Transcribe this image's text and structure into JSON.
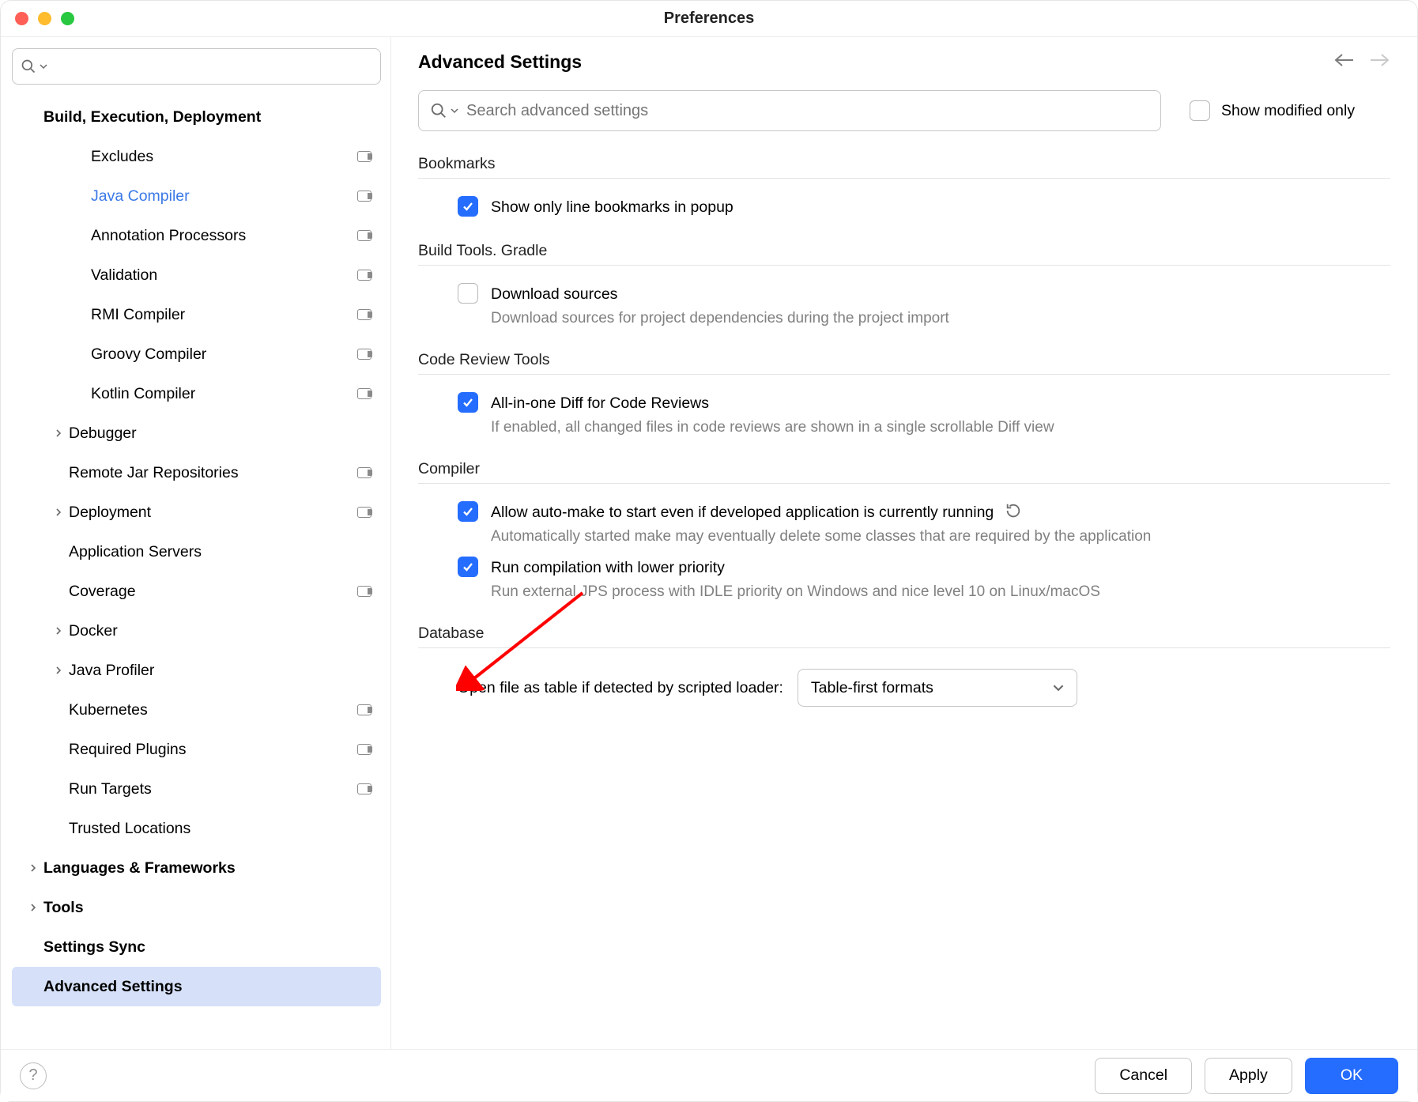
{
  "window": {
    "title": "Preferences"
  },
  "sidebar": {
    "search_placeholder": "",
    "items": [
      {
        "label": "Build, Execution, Deployment",
        "indent": 40,
        "bold": true,
        "chevron": false,
        "badge": false,
        "interactable": true
      },
      {
        "label": "Excludes",
        "indent": 100,
        "bold": false,
        "chevron": false,
        "badge": true,
        "interactable": true
      },
      {
        "label": "Java Compiler",
        "indent": 100,
        "bold": false,
        "chevron": false,
        "badge": true,
        "interactable": true,
        "blue": true
      },
      {
        "label": "Annotation Processors",
        "indent": 100,
        "bold": false,
        "chevron": false,
        "badge": true,
        "interactable": true
      },
      {
        "label": "Validation",
        "indent": 100,
        "bold": false,
        "chevron": false,
        "badge": true,
        "interactable": true
      },
      {
        "label": "RMI Compiler",
        "indent": 100,
        "bold": false,
        "chevron": false,
        "badge": true,
        "interactable": true
      },
      {
        "label": "Groovy Compiler",
        "indent": 100,
        "bold": false,
        "chevron": false,
        "badge": true,
        "interactable": true
      },
      {
        "label": "Kotlin Compiler",
        "indent": 100,
        "bold": false,
        "chevron": false,
        "badge": true,
        "interactable": true
      },
      {
        "label": "Debugger",
        "indent": 72,
        "bold": false,
        "chevron": true,
        "badge": false,
        "interactable": true
      },
      {
        "label": "Remote Jar Repositories",
        "indent": 72,
        "bold": false,
        "chevron": false,
        "badge": true,
        "interactable": true
      },
      {
        "label": "Deployment",
        "indent": 72,
        "bold": false,
        "chevron": true,
        "badge": true,
        "interactable": true
      },
      {
        "label": "Application Servers",
        "indent": 72,
        "bold": false,
        "chevron": false,
        "badge": false,
        "interactable": true
      },
      {
        "label": "Coverage",
        "indent": 72,
        "bold": false,
        "chevron": false,
        "badge": true,
        "interactable": true
      },
      {
        "label": "Docker",
        "indent": 72,
        "bold": false,
        "chevron": true,
        "badge": false,
        "interactable": true
      },
      {
        "label": "Java Profiler",
        "indent": 72,
        "bold": false,
        "chevron": true,
        "badge": false,
        "interactable": true
      },
      {
        "label": "Kubernetes",
        "indent": 72,
        "bold": false,
        "chevron": false,
        "badge": true,
        "interactable": true
      },
      {
        "label": "Required Plugins",
        "indent": 72,
        "bold": false,
        "chevron": false,
        "badge": true,
        "interactable": true
      },
      {
        "label": "Run Targets",
        "indent": 72,
        "bold": false,
        "chevron": false,
        "badge": true,
        "interactable": true
      },
      {
        "label": "Trusted Locations",
        "indent": 72,
        "bold": false,
        "chevron": false,
        "badge": false,
        "interactable": true
      },
      {
        "label": "Languages & Frameworks",
        "indent": 40,
        "bold": true,
        "chevron": true,
        "badge": false,
        "interactable": true
      },
      {
        "label": "Tools",
        "indent": 40,
        "bold": true,
        "chevron": true,
        "badge": false,
        "interactable": true
      },
      {
        "label": "Settings Sync",
        "indent": 40,
        "bold": true,
        "chevron": false,
        "badge": false,
        "interactable": true
      },
      {
        "label": "Advanced Settings",
        "indent": 40,
        "bold": true,
        "chevron": false,
        "badge": false,
        "interactable": true,
        "selected": true
      }
    ]
  },
  "main": {
    "title": "Advanced Settings",
    "search_placeholder": "Search advanced settings",
    "show_modified_label": "Show modified only",
    "show_modified_checked": false,
    "sections": {
      "bookmarks": {
        "title": "Bookmarks",
        "opt1_label": "Show only line bookmarks in popup",
        "opt1_checked": true
      },
      "gradle": {
        "title": "Build Tools. Gradle",
        "opt1_label": "Download sources",
        "opt1_desc": "Download sources for project dependencies during the project import",
        "opt1_checked": false
      },
      "review": {
        "title": "Code Review Tools",
        "opt1_label": "All-in-one Diff for Code Reviews",
        "opt1_desc": "If enabled, all changed files in code reviews are shown in a single scrollable Diff view",
        "opt1_checked": true
      },
      "compiler": {
        "title": "Compiler",
        "opt1_label": "Allow auto-make to start even if developed application is currently running",
        "opt1_desc": "Automatically started make may eventually delete some classes that are required by the application",
        "opt1_checked": true,
        "opt1_has_reset": true,
        "opt2_label": "Run compilation with lower priority",
        "opt2_desc": "Run external JPS process with IDLE priority on Windows and nice level 10 on Linux/macOS",
        "opt2_checked": true
      },
      "database": {
        "title": "Database",
        "field_label": "Open file as table if detected by scripted loader:",
        "selected_value": "Table-first formats"
      }
    }
  },
  "footer": {
    "cancel": "Cancel",
    "apply": "Apply",
    "ok": "OK"
  }
}
